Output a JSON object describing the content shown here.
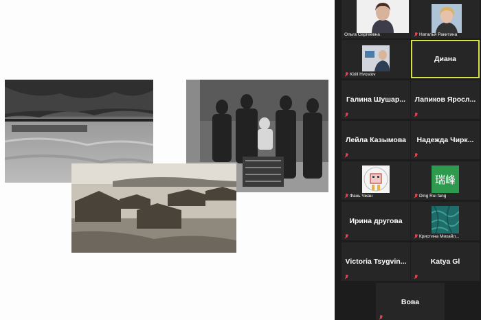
{
  "screen_share": {
    "photos": [
      {
        "name": "photo-river-cliffs"
      },
      {
        "name": "photo-family-portrait"
      },
      {
        "name": "photo-village"
      }
    ]
  },
  "participants": [
    {
      "name": "Ольга Сергеевна",
      "display": "video",
      "muted": false
    },
    {
      "name": "Наталья Ракитина",
      "display": "video",
      "muted": true
    },
    {
      "name": "Kirill Hvostov",
      "display": "video",
      "muted": true
    },
    {
      "name": "Диана",
      "display": "name",
      "muted": false,
      "active_speaker": true
    },
    {
      "name": "Галина  Шушар...",
      "display": "name",
      "muted": true
    },
    {
      "name": "Лапиков  Яросл...",
      "display": "name",
      "muted": true
    },
    {
      "name": "Лейла Казымова",
      "display": "name",
      "muted": true
    },
    {
      "name": "Надежда  Чирк...",
      "display": "name",
      "muted": true
    },
    {
      "name": "Фань Чжан",
      "display": "avatar",
      "avatar": "robot-drawing",
      "muted": true
    },
    {
      "name": "Ding Rui fang",
      "display": "avatar",
      "avatar_text": "瑞峰",
      "avatar_color": "#2e9a4e",
      "muted": true
    },
    {
      "name": "Ирина другова",
      "display": "name",
      "muted": true
    },
    {
      "name": "Кристина Михайл...",
      "display": "avatar",
      "avatar": "teal-texture",
      "muted": true
    },
    {
      "name": "Victoria  Tsygvin...",
      "display": "name",
      "muted": true
    },
    {
      "name": "Katya Gl",
      "display": "name",
      "muted": true
    },
    {
      "name": "Вова",
      "display": "name",
      "muted": true
    }
  ],
  "colors": {
    "active_border": "#d6e24a",
    "mute": "#e0424f",
    "tile_bg": "#262626",
    "panel_bg": "#1c1c1c"
  }
}
